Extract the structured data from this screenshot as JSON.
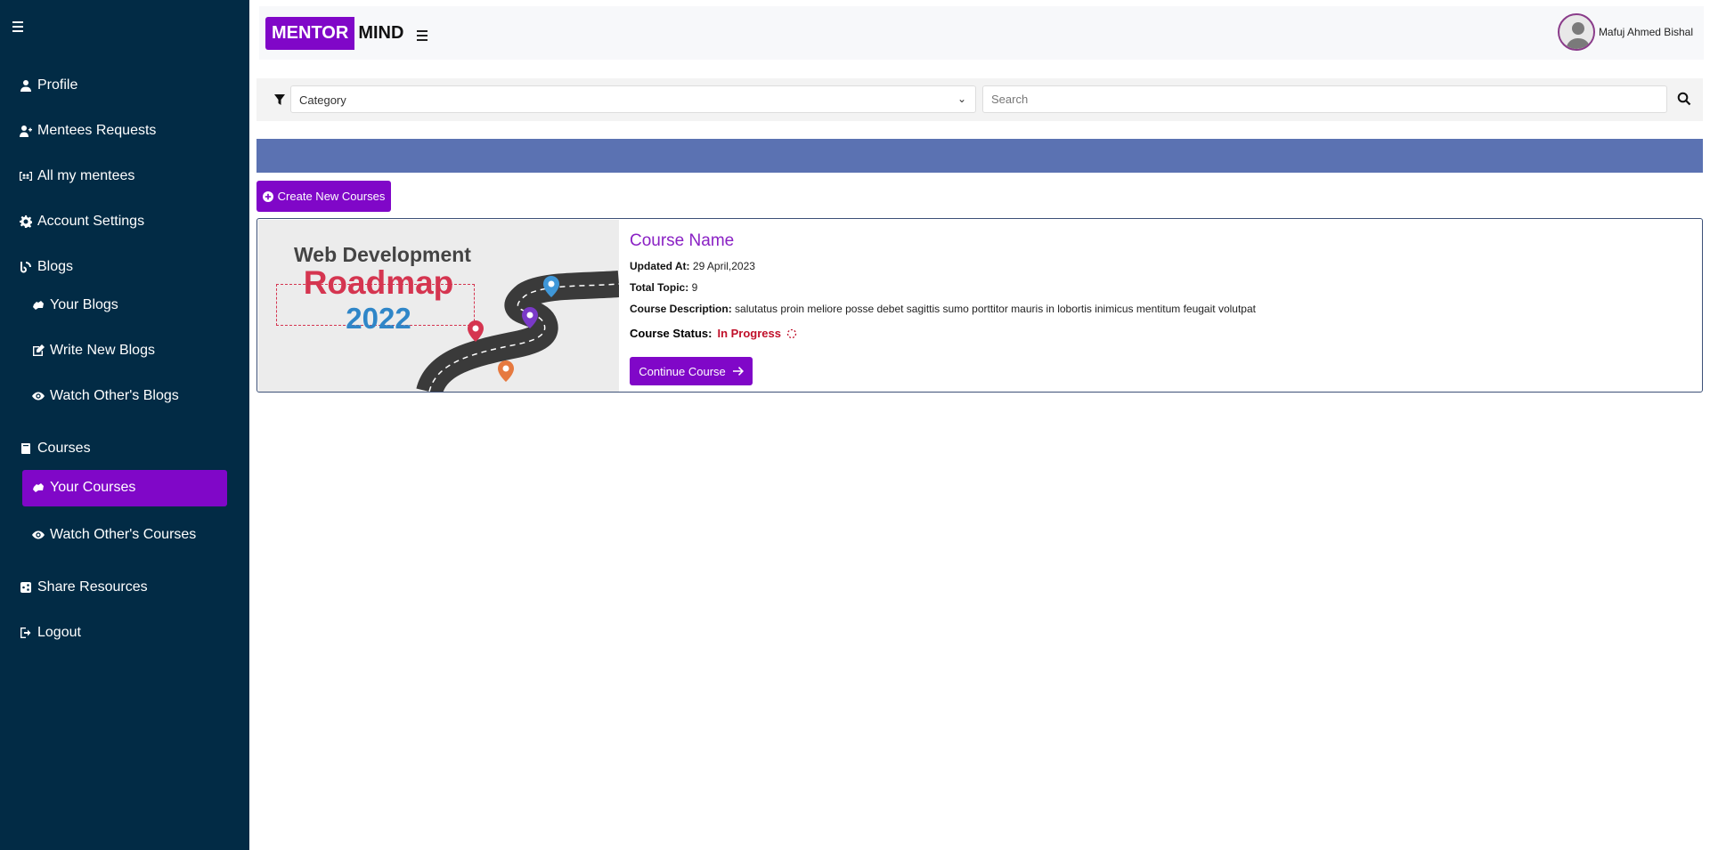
{
  "sidebar": {
    "items": [
      {
        "label": "Profile",
        "icon": "user-icon"
      },
      {
        "label": "Mentees Requests",
        "icon": "user-plus-icon"
      },
      {
        "label": "All my mentees",
        "icon": "users-card-icon"
      },
      {
        "label": "Account Settings",
        "icon": "gear-icon"
      },
      {
        "label": "Blogs",
        "icon": "blog-icon"
      },
      {
        "label": "Your Blogs",
        "icon": "hand-icon"
      },
      {
        "label": "Write New Blogs",
        "icon": "edit-icon"
      },
      {
        "label": "Watch Other's Blogs",
        "icon": "eye-icon"
      },
      {
        "label": "Courses",
        "icon": "book-icon"
      },
      {
        "label": "Your Courses",
        "icon": "hand-icon",
        "active": true
      },
      {
        "label": "Watch Other's Courses",
        "icon": "eye-icon"
      },
      {
        "label": "Share Resources",
        "icon": "share-icon"
      },
      {
        "label": "Logout",
        "icon": "logout-icon"
      }
    ]
  },
  "header": {
    "logo_part1": "MENTOR",
    "logo_part2": "MIND",
    "user_name": "Mafuj Ahmed Bishal"
  },
  "filters": {
    "category_value": "Category",
    "search_placeholder": "Search"
  },
  "actions": {
    "create_label": "Create New Courses"
  },
  "course": {
    "thumb_line1": "Web Development",
    "thumb_line2": "Roadmap",
    "thumb_line3": "2022",
    "name": "Course Name",
    "updated_label": "Updated At:",
    "updated_value": "29 April,2023",
    "topic_label": "Total Topic:",
    "topic_value": "9",
    "desc_label": "Course Description:",
    "desc_value": "salutatus proin meliore posse debet sagittis sumo porttitor mauris in lobortis inimicus mentitum feugait volutpat",
    "status_label": "Course Status:",
    "status_value": "In Progress",
    "continue_label": "Continue Course"
  },
  "colors": {
    "sidebar_bg": "#022b45",
    "accent": "#8007c8",
    "banner": "#5b72b2",
    "status": "#c0102a"
  }
}
